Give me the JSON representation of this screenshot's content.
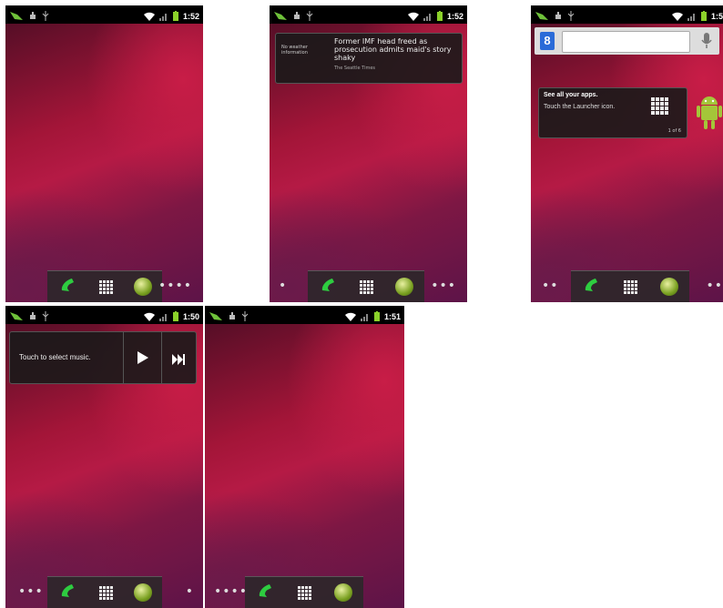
{
  "screens": [
    {
      "time": "1:52",
      "dots_right": "••••"
    },
    {
      "time": "1:52",
      "dots_left": "•",
      "dots_right": "•••",
      "news": {
        "weather": "No weather information",
        "headline": "Former IMF head freed as prosecution admits maid's story shaky",
        "source": "The Seattle Times"
      }
    },
    {
      "time": "1:5",
      "dots_left": "••",
      "dots_right": "••",
      "tip": {
        "title": "See all your apps.",
        "body": "Touch the Launcher icon.",
        "page": "1 of 6"
      }
    },
    {
      "time": "1:50",
      "dots_left": "•••",
      "dots_right": "•",
      "music": {
        "label": "Touch to select music."
      }
    },
    {
      "time": "1:51",
      "dots_left": "••••"
    }
  ],
  "icons": {
    "phone": "phone-icon",
    "launcher": "launcher-grid-icon",
    "browser": "browser-globe-icon",
    "play": "play-icon",
    "next": "next-track-icon",
    "google": "google-logo-icon",
    "mic": "microphone-icon",
    "android": "android-robot-icon"
  },
  "colors": {
    "status_bar": "#000000",
    "wallpaper_accent": "#b51a45",
    "dock": "#282828",
    "phone_green": "#2ecc40"
  }
}
